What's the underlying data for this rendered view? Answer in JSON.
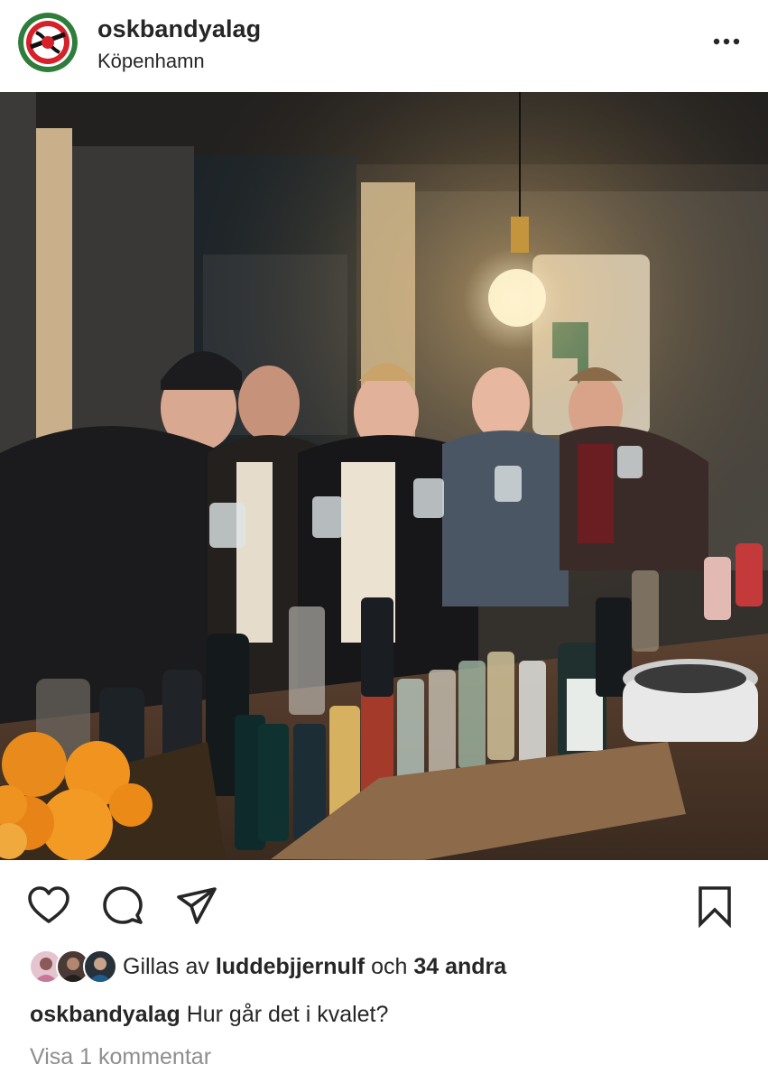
{
  "post": {
    "username": "oskbandyalag",
    "location": "Köpenhamn",
    "likes": {
      "prefix": "Gillas av",
      "liker": "luddebjjernulf",
      "connector": "och",
      "others": "34 andra"
    },
    "caption_text": "Hur går det i kvalet?",
    "view_comments": "Visa 1 kommentar"
  },
  "icons": {
    "more": "more-horizontal-icon",
    "like": "heart-icon",
    "comment": "comment-icon",
    "share": "paper-plane-icon",
    "save": "bookmark-icon"
  },
  "colors": {
    "text": "#262626",
    "secondary": "#8e8e8e",
    "logo_red": "#d6202a",
    "logo_green": "#2f7d3a"
  }
}
